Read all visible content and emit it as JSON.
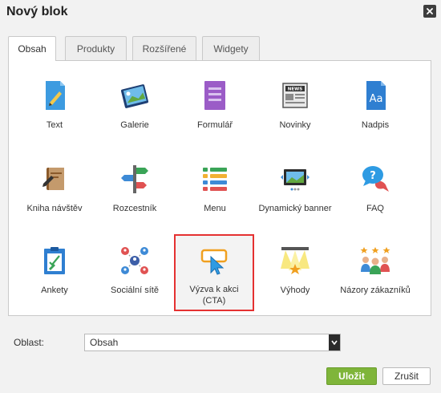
{
  "dialog": {
    "title": "Nový blok"
  },
  "tabs": [
    {
      "label": "Obsah",
      "active": true
    },
    {
      "label": "Produkty",
      "active": false
    },
    {
      "label": "Rozšířené",
      "active": false
    },
    {
      "label": "Widgety",
      "active": false
    }
  ],
  "blocks": [
    {
      "label": "Text",
      "icon": "text-icon"
    },
    {
      "label": "Galerie",
      "icon": "gallery-icon"
    },
    {
      "label": "Formulář",
      "icon": "form-icon"
    },
    {
      "label": "Novinky",
      "icon": "news-icon"
    },
    {
      "label": "Nadpis",
      "icon": "heading-icon"
    },
    {
      "label": "Kniha návštěv",
      "icon": "guestbook-icon"
    },
    {
      "label": "Rozcestník",
      "icon": "signpost-icon"
    },
    {
      "label": "Menu",
      "icon": "menu-icon"
    },
    {
      "label": "Dynamický banner",
      "icon": "banner-icon"
    },
    {
      "label": "FAQ",
      "icon": "faq-icon"
    },
    {
      "label": "Ankety",
      "icon": "poll-icon"
    },
    {
      "label": "Sociální sítě",
      "icon": "social-icon"
    },
    {
      "label": "Výzva k akci (CTA)",
      "icon": "cta-icon",
      "selected": true
    },
    {
      "label": "Výhody",
      "icon": "benefits-icon"
    },
    {
      "label": "Názory zákazníků",
      "icon": "testimonials-icon"
    }
  ],
  "area": {
    "label": "Oblast:",
    "value": "Obsah"
  },
  "buttons": {
    "save": "Uložit",
    "cancel": "Zrušit"
  },
  "colors": {
    "save_bg": "#7fb53a",
    "selection_border": "#e53131"
  }
}
